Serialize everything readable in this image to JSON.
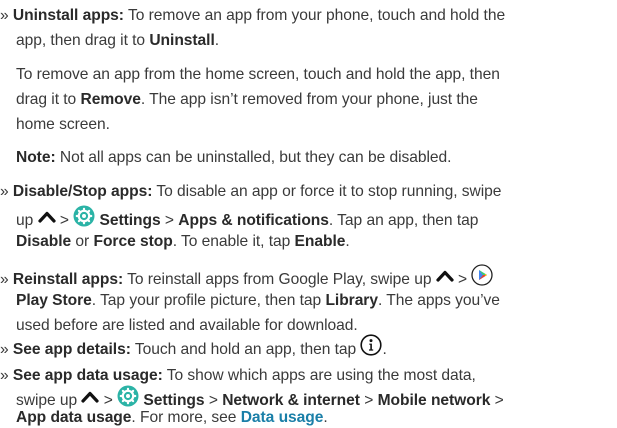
{
  "colors": {
    "text": "#3a3a3a",
    "link": "#1a7fa8",
    "settings_icon": "#2bb3a6",
    "play_icon": [
      "#3ecf6f",
      "#fbbc05",
      "#ea4335",
      "#4285f4"
    ]
  },
  "bullet_marker": "»",
  "separator": ">",
  "uninstall": {
    "label": "Uninstall apps:",
    "l1": "To remove an app from your phone, touch and hold the",
    "l2a": "app, then drag it to",
    "target": "Uninstall",
    "end": "."
  },
  "remove_para": {
    "l1": "To remove an app from the home screen, touch and hold the app, then",
    "l2a": "drag it to",
    "target": "Remove",
    "l2b": ". The app isn’t removed from your phone, just the",
    "l3": "home screen."
  },
  "note": {
    "label": "Note:",
    "text": "Not all apps can be uninstalled, but they can be disabled."
  },
  "disable": {
    "label": "Disable/Stop apps:",
    "l1": "To disable an app or force it to stop running, swipe",
    "l2a": "up",
    "settings": "Settings",
    "apps": "Apps & notifications",
    "l2b": ". Tap an app, then tap",
    "disable": "Disable",
    "or": "or",
    "force": "Force stop",
    "l3b": ". To enable it, tap",
    "enable": "Enable",
    "end": "."
  },
  "reinstall": {
    "label": "Reinstall apps:",
    "l1": "To reinstall apps from Google Play, swipe up",
    "store": "Play Store",
    "l2b": ". Tap your profile picture, then tap",
    "library": "Library",
    "l2c": ". The apps you’ve",
    "l3": "used before are listed and available for download."
  },
  "details": {
    "label": "See app details:",
    "text": "Touch and hold an app, then tap",
    "end": "."
  },
  "usage": {
    "label": "See app data usage:",
    "l1": "To show which apps are using the most data,",
    "l2a": "swipe up",
    "settings": "Settings",
    "network": "Network & internet",
    "mobile": "Mobile network",
    "l4a": "App data usage",
    "l4b": ". For more, see",
    "link": "Data usage",
    "end": "."
  }
}
